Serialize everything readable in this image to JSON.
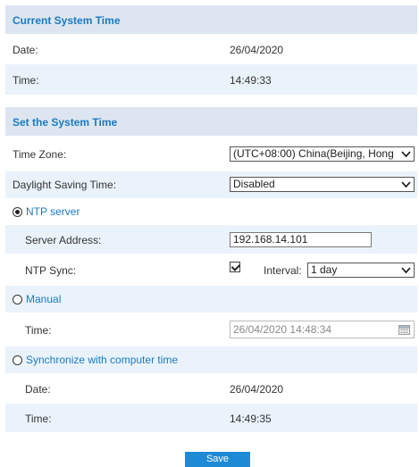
{
  "current_time": {
    "title": "Current System Time",
    "date_label": "Date:",
    "date_value": "26/04/2020",
    "time_label": "Time:",
    "time_value": "14:49:33"
  },
  "set_time": {
    "title": "Set the System Time",
    "timezone_label": "Time Zone:",
    "timezone_value": "(UTC+08:00) China(Beijing, Hong",
    "dst_label": "Daylight Saving Time:",
    "dst_value": "Disabled",
    "ntp": {
      "label": "NTP server",
      "selected": true,
      "server_label": "Server Address:",
      "server_value": "192.168.14.101",
      "sync_label": "NTP Sync:",
      "sync_checked": true,
      "interval_label": "Interval:",
      "interval_value": "1 day"
    },
    "manual": {
      "label": "Manual",
      "selected": false,
      "time_label": "Time:",
      "time_value": "26/04/2020 14:48:34"
    },
    "computer": {
      "label": "Synchronize with computer time",
      "selected": false,
      "date_label": "Date:",
      "date_value": "26/04/2020",
      "time_label": "Time:",
      "time_value": "14:49:35"
    }
  },
  "save_label": "Save",
  "colors": {
    "accent": "#1a7ac2",
    "header_bg": "#dde6f0",
    "alt_row_bg": "#eaf3fb",
    "button_bg": "#1e8ad6"
  }
}
